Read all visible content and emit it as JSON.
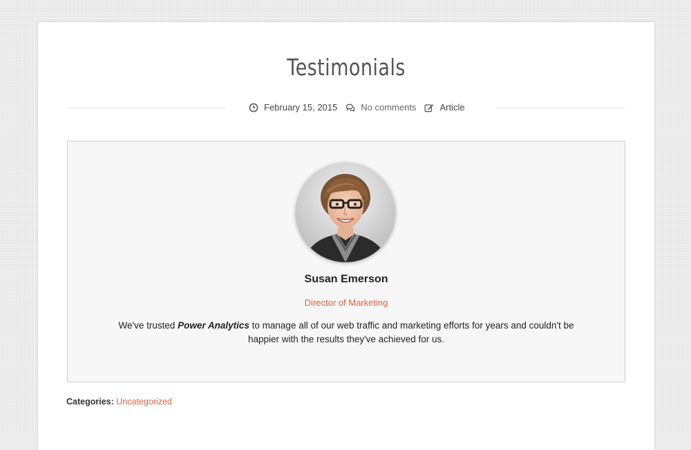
{
  "post": {
    "title": "Testimonials",
    "date": "February 15, 2015",
    "comments": "No comments",
    "type": "Article"
  },
  "testimonial": {
    "name": "Susan Emerson",
    "role": "Director of Marketing",
    "quote_before": "We've trusted ",
    "quote_company": "Power Analytics",
    "quote_after": " to manage all of our web traffic and marketing efforts for years and couldn't be happier with the results they've achieved for us."
  },
  "footer": {
    "categories_label": "Categories:",
    "category": "Uncategorized"
  },
  "colors": {
    "accent": "#e8603c",
    "background": "#ebebeb",
    "card": "#ffffff",
    "box": "#f7f7f7"
  },
  "icons": {
    "date": "clock-icon",
    "comments": "comments-icon",
    "type": "edit-icon"
  }
}
